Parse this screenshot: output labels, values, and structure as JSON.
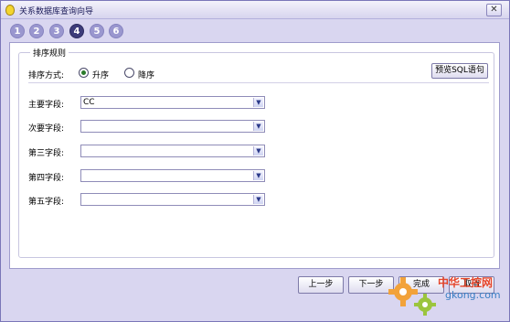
{
  "window": {
    "title": "关系数据库查询向导",
    "close_label": "✕"
  },
  "steps": [
    {
      "label": "1",
      "active": false
    },
    {
      "label": "2",
      "active": false
    },
    {
      "label": "3",
      "active": false
    },
    {
      "label": "4",
      "active": true
    },
    {
      "label": "5",
      "active": false
    },
    {
      "label": "6",
      "active": false
    }
  ],
  "sort": {
    "group_title": "排序规则",
    "order_label": "排序方式:",
    "ascending_label": "升序",
    "descending_label": "降序",
    "selected": "ascending",
    "preview_button": "预览SQL语句"
  },
  "fields": [
    {
      "label": "主要字段:",
      "value": "CC"
    },
    {
      "label": "次要字段:",
      "value": ""
    },
    {
      "label": "第三字段:",
      "value": ""
    },
    {
      "label": "第四字段:",
      "value": ""
    },
    {
      "label": "第五字段:",
      "value": ""
    }
  ],
  "buttons": {
    "prev": "上一步",
    "next": "下一步",
    "finish": "完成",
    "cancel": "取消"
  },
  "watermark": {
    "brand": "中华工控网",
    "url": "gkong.com"
  },
  "colors": {
    "window_bg": "#d9d6f0",
    "active_step": "#3d3c7a",
    "inactive_step": "#9a97cf"
  }
}
